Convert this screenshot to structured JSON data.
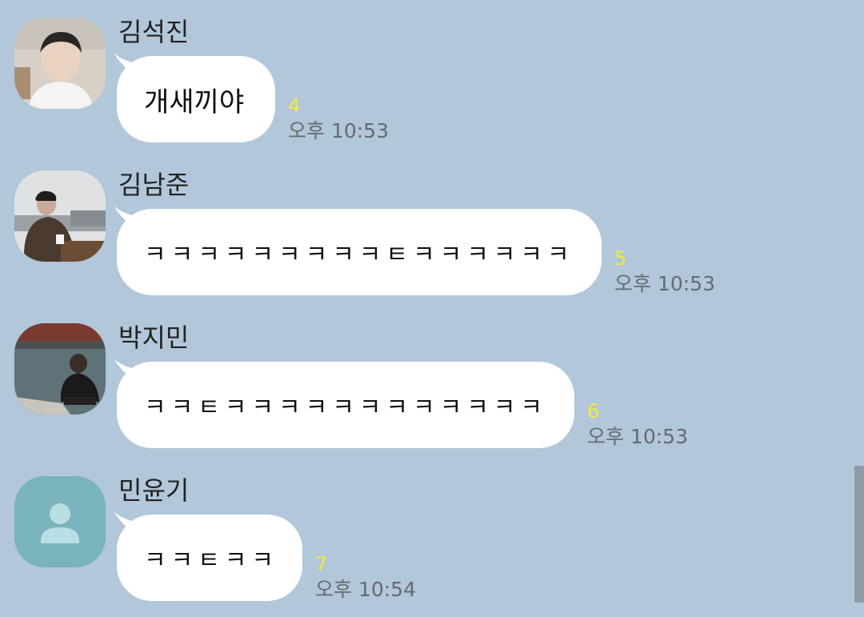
{
  "chat": {
    "messages": [
      {
        "sender": "김석진",
        "text": "개새끼야",
        "unread": "4",
        "time": "오후 10:53"
      },
      {
        "sender": "김남준",
        "text": "ㅋㅋㅋㅋㅋㅋㅋㅋㅋㅌㅋㅋㅋㅋㅋㅋ",
        "unread": "5",
        "time": "오후 10:53"
      },
      {
        "sender": "박지민",
        "text": "ㅋㅋㅌㅋㅋㅋㅋㅋㅋㅋㅋㅋㅋㅋㅋ",
        "unread": "6",
        "time": "오후 10:53"
      },
      {
        "sender": "민윤기",
        "text": "ㅋㅋㅌㅋㅋ",
        "unread": "7",
        "time": "오후 10:54"
      }
    ]
  }
}
